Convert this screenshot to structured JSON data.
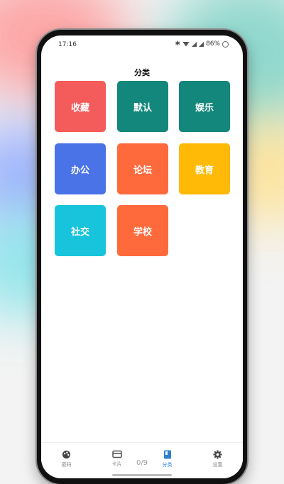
{
  "status_bar": {
    "time": "17:16",
    "battery": "86%"
  },
  "header": {
    "title": "分类"
  },
  "categories": [
    {
      "label": "收藏",
      "color": "#f45b5b"
    },
    {
      "label": "默认",
      "color": "#13877b"
    },
    {
      "label": "娱乐",
      "color": "#13877b"
    },
    {
      "label": "办公",
      "color": "#4b73e8"
    },
    {
      "label": "论坛",
      "color": "#ff6a3d"
    },
    {
      "label": "教育",
      "color": "#ffba08"
    },
    {
      "label": "社交",
      "color": "#17c4dc"
    },
    {
      "label": "学校",
      "color": "#ff6a3d"
    }
  ],
  "tabbar": {
    "tabs": [
      {
        "label": "密码",
        "icon": "palette-icon"
      },
      {
        "label": "卡片",
        "icon": "card-icon"
      },
      {
        "label": "分类",
        "icon": "category-icon",
        "active": true
      },
      {
        "label": "设置",
        "icon": "gear-icon"
      }
    ]
  },
  "pager": {
    "text": "0/9"
  },
  "colors": {
    "accent": "#2f7fd0"
  }
}
